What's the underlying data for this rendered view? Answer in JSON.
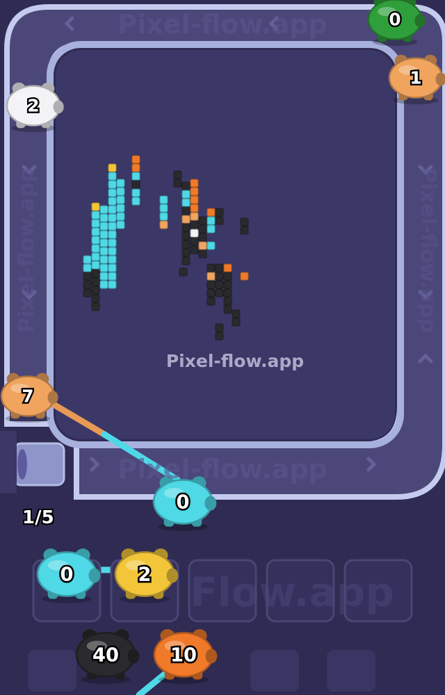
{
  "watermark": "Pixel-flow.app",
  "track_text": [
    "Pixel-flow.app",
    "Pixel-flow.app",
    "Pixel-flow.app",
    "Pixel-flow.app"
  ],
  "bottom_watermark": "Flow.app",
  "queue_progress": "1/5",
  "colors": {
    "background": "#2f2b52",
    "board": "#3c3866",
    "track": "#aeb7dd",
    "cyan": "#4fd8e6",
    "orange": "#f0a45e",
    "deep_orange": "#f07a2a",
    "yellow": "#f3c63a",
    "green": "#2f9f3b",
    "white": "#f3f3f6",
    "black": "#2a2a2e"
  },
  "pigs_on_track": [
    {
      "name": "green-pig",
      "color": "green",
      "count": "0"
    },
    {
      "name": "orange-pig-top-right",
      "color": "orange",
      "count": "1"
    },
    {
      "name": "white-pig",
      "color": "white",
      "count": "2"
    },
    {
      "name": "orange-pig-left",
      "color": "orange",
      "count": "7"
    }
  ],
  "active_pig": {
    "color": "cyan",
    "count": "0"
  },
  "slots": [
    {
      "color": "cyan",
      "count": "0"
    },
    {
      "color": "yellow",
      "count": "2"
    },
    {
      "empty": true
    },
    {
      "empty": true
    },
    {
      "empty": true
    }
  ],
  "queue": [
    {
      "color": "black",
      "count": "40"
    },
    {
      "color": "deep_orange",
      "count": "10"
    }
  ]
}
